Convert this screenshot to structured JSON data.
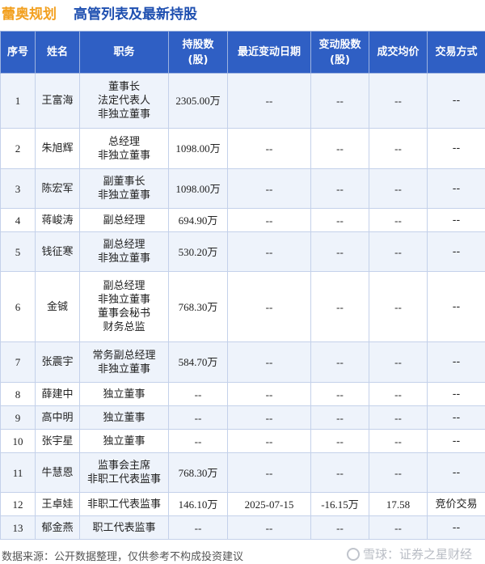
{
  "header": {
    "company": "蕾奥规划",
    "subtitle": "高管列表及最新持股"
  },
  "table": {
    "columns": [
      "序号",
      "姓名",
      "职务",
      "持股数\n(股)",
      "最近变动日期",
      "变动股数\n(股)",
      "成交均价",
      "交易方式"
    ],
    "rows": [
      {
        "no": "1",
        "name": "王富海",
        "roles": [
          "董事长",
          "法定代表人",
          "非独立董事"
        ],
        "shares": "2305.00万",
        "date": "--",
        "change": "--",
        "price": "--",
        "method": "--"
      },
      {
        "no": "2",
        "name": "朱旭辉",
        "roles": [
          "总经理",
          "非独立董事"
        ],
        "shares": "1098.00万",
        "date": "--",
        "change": "--",
        "price": "--",
        "method": "--"
      },
      {
        "no": "3",
        "name": "陈宏军",
        "roles": [
          "副董事长",
          "非独立董事"
        ],
        "shares": "1098.00万",
        "date": "--",
        "change": "--",
        "price": "--",
        "method": "--"
      },
      {
        "no": "4",
        "name": "蒋峻涛",
        "roles": [
          "副总经理"
        ],
        "shares": "694.90万",
        "date": "--",
        "change": "--",
        "price": "--",
        "method": "--"
      },
      {
        "no": "5",
        "name": "钱征寒",
        "roles": [
          "副总经理",
          "非独立董事"
        ],
        "shares": "530.20万",
        "date": "--",
        "change": "--",
        "price": "--",
        "method": "--"
      },
      {
        "no": "6",
        "name": "金铖",
        "roles": [
          "副总经理",
          "非独立董事",
          "董事会秘书",
          "财务总监"
        ],
        "shares": "768.30万",
        "date": "--",
        "change": "--",
        "price": "--",
        "method": "--"
      },
      {
        "no": "7",
        "name": "张震宇",
        "roles": [
          "常务副总经理",
          "非独立董事"
        ],
        "shares": "584.70万",
        "date": "--",
        "change": "--",
        "price": "--",
        "method": "--"
      },
      {
        "no": "8",
        "name": "薛建中",
        "roles": [
          "独立董事"
        ],
        "shares": "--",
        "date": "--",
        "change": "--",
        "price": "--",
        "method": "--"
      },
      {
        "no": "9",
        "name": "高中明",
        "roles": [
          "独立董事"
        ],
        "shares": "--",
        "date": "--",
        "change": "--",
        "price": "--",
        "method": "--"
      },
      {
        "no": "10",
        "name": "张宇星",
        "roles": [
          "独立董事"
        ],
        "shares": "--",
        "date": "--",
        "change": "--",
        "price": "--",
        "method": "--"
      },
      {
        "no": "11",
        "name": "牛慧恩",
        "roles": [
          "监事会主席",
          "非职工代表监事"
        ],
        "shares": "768.30万",
        "date": "--",
        "change": "--",
        "price": "--",
        "method": "--"
      },
      {
        "no": "12",
        "name": "王卓娃",
        "roles": [
          "非职工代表监事"
        ],
        "shares": "146.10万",
        "date": "2025-07-15",
        "change": "-16.15万",
        "price": "17.58",
        "method": "竞价交易"
      },
      {
        "no": "13",
        "name": "郁金燕",
        "roles": [
          "职工代表监事"
        ],
        "shares": "--",
        "date": "--",
        "change": "--",
        "price": "--",
        "method": "--"
      }
    ]
  },
  "footer": {
    "source": "数据来源：公开数据整理，仅供参考不构成投资建议",
    "brand": "雪球：证券之星财经"
  },
  "watermark": "证券之星",
  "colors": {
    "header_bg": "#2f5fc4",
    "company": "#f2a020",
    "subtitle": "#1e4fb0",
    "negative": "#1a9a3a",
    "stripe": "#eef3fb"
  }
}
